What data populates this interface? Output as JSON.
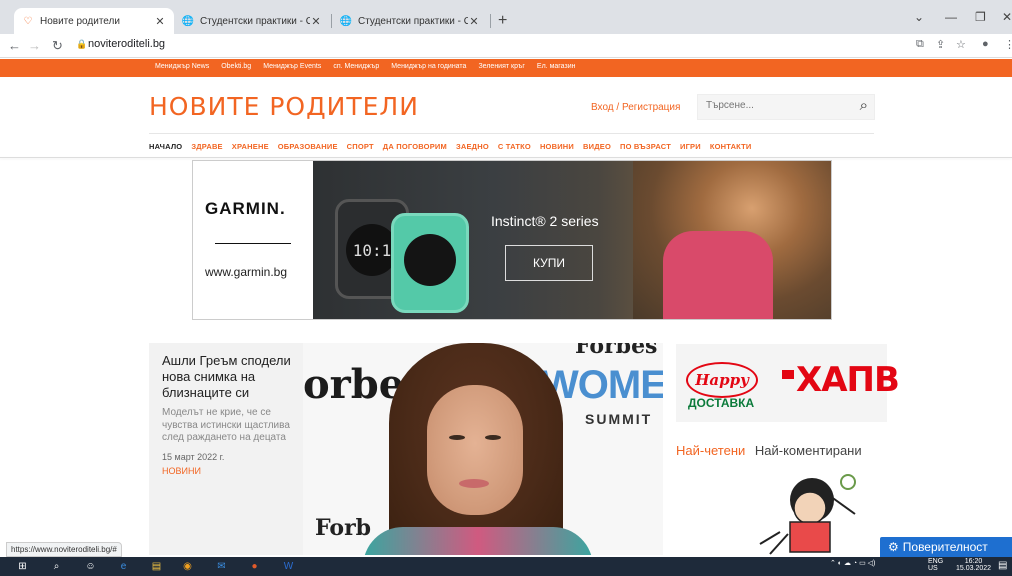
{
  "browser": {
    "tabs": [
      {
        "title": "Новите родители",
        "icon": "heart-logo-icon"
      },
      {
        "title": "Студентски практики - Обяви",
        "icon": "globe-icon"
      },
      {
        "title": "Студентски практики - Обява",
        "icon": "globe-icon"
      }
    ],
    "url": "noviteroditeli.bg",
    "status_url": "https://www.noviteroditeli.bg/#"
  },
  "topstrip": {
    "links": [
      "Мениджър News",
      "Obekti.bg",
      "Мениджър Events",
      "сп. Мениджър",
      "Мениджър на годината",
      "Зеленият кръг",
      "Ел. магазин"
    ]
  },
  "header": {
    "logo": "НОВИТЕ РОДИТЕЛИ",
    "login": "Вход / Регистрация",
    "search_placeholder": "Търсене..."
  },
  "nav": [
    "НАЧАЛО",
    "ЗДРАВЕ",
    "ХРАНЕНЕ",
    "ОБРАЗОВАНИЕ",
    "СПОРТ",
    "ДА ПОГОВОРИМ",
    "ЗАЕДНО",
    "С ТАТКО",
    "НОВИНИ",
    "ВИДЕО",
    "ПО ВЪЗРАСТ",
    "ИГРИ",
    "КОНТАКТИ"
  ],
  "ad": {
    "brand": "GARMIN.",
    "site": "www.garmin.bg",
    "product": "Instinct® 2 series",
    "cta": "КУПИ",
    "watch_time": "10:1"
  },
  "article": {
    "headline": "Ашли Греъм сподели нова снимка на близнаците си",
    "summary": "Моделът не крие, че се чувства истински щастлива след раждането на децата",
    "date": "15 март 2022 г.",
    "category": "НОВИНИ",
    "image_text": {
      "forbes_left": "orbe",
      "forbes_top": "Forbes",
      "women": "WOMEN",
      "summit": "SUMMIT",
      "forbes_bottom": "Forb"
    }
  },
  "sidebar": {
    "promo": {
      "happy": "Happy",
      "dostavka": "ДОСТАВКА",
      "xapb": "ХАПВ"
    },
    "tabs": [
      "Най-четени",
      "Най-коментирани"
    ]
  },
  "privacy": "Поверителност",
  "taskbar": {
    "lang": "ENG",
    "lang2": "US",
    "time": "16:20",
    "date": "15.03.2022"
  },
  "colors": {
    "accent": "#f26522",
    "privacy": "#1e6fd0"
  }
}
